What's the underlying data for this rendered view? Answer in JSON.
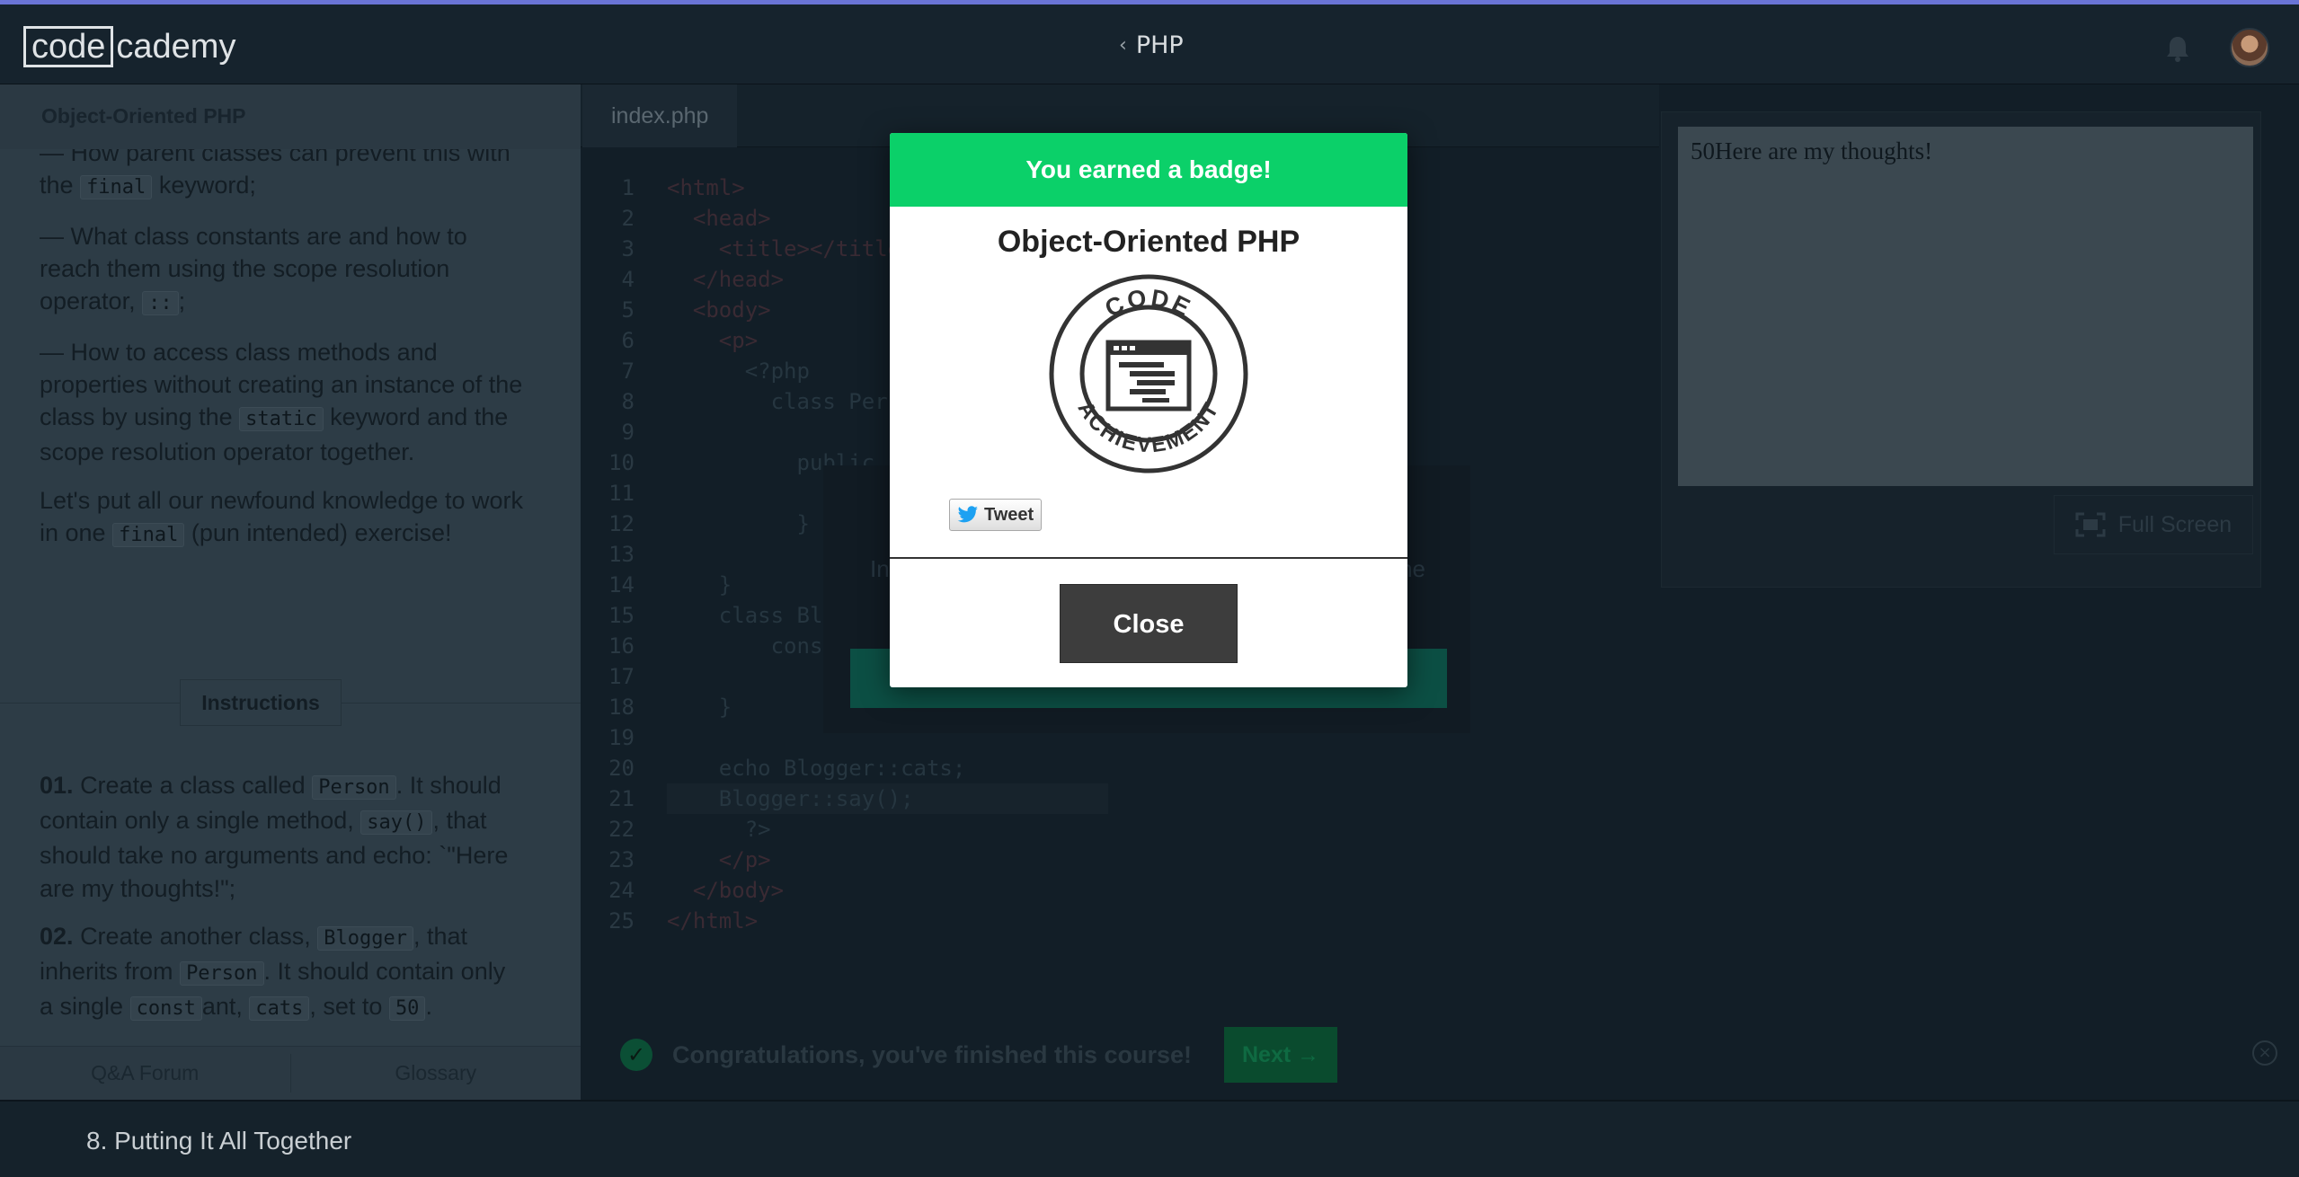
{
  "header": {
    "logo_boxed": "code",
    "logo_rest": "cademy",
    "course_back_label": "PHP"
  },
  "lesson": {
    "sticky_title": "Object-Oriented PHP",
    "para1_a": "— How parent classes can prevent this with the",
    "para1_code": "final",
    "para1_b": "keyword;",
    "para2_a": "— What class constants are and how to reach them using the scope resolution operator,",
    "para2_code": "::",
    "para2_b": ";",
    "para3_a": "— How to access class methods and properties without creating an instance of the class by using the",
    "para3_code": "static",
    "para3_b": "keyword and the scope resolution operator together.",
    "para4_a": "Let's put all our newfound knowledge to work in one",
    "para4_code": "final",
    "para4_b": "(pun intended) exercise!",
    "instructions_label": "Instructions",
    "step1_num": "01.",
    "step1_a": "Create a class called",
    "step1_code1": "Person",
    "step1_b": ". It should contain only a single method,",
    "step1_code2": "say()",
    "step1_c": ", that should take no arguments and echo: `\"Here are my thoughts!\";",
    "step2_num": "02.",
    "step2_a": "Create another class,",
    "step2_code1": "Blogger",
    "step2_b": ", that inherits from",
    "step2_code2": "Person",
    "step2_c": ". It should contain only a single",
    "step2_code3": "const",
    "step2_d": "ant,",
    "step2_code4": "cats",
    "step2_e": ", set to",
    "step2_code5": "50",
    "step2_f": ".",
    "footer_qa": "Q&A Forum",
    "footer_glossary": "Glossary"
  },
  "editor": {
    "tab_label": "index.php",
    "line_numbers": [
      "1",
      "2",
      "3",
      "4",
      "5",
      "6",
      "7",
      "8",
      "9",
      "10",
      "11",
      "12",
      "13",
      "14",
      "15",
      "16",
      "17",
      "18",
      "19",
      "20",
      "21",
      "22",
      "23",
      "24",
      "25"
    ],
    "lines": [
      "<html>",
      "  <head>",
      "    <title></title>",
      "  </head>",
      "  <body>",
      "    <p>",
      "      <?php",
      "        class Person {",
      "",
      "          public function say() {",
      "",
      "          }",
      "",
      "    }",
      "    class Blogger extends Person {",
      "        const cats = 50;",
      "",
      "    }",
      "",
      "    echo Blogger::cats;",
      "    Blogger::say();",
      "      ?>",
      "    </p>",
      "  </body>",
      "</html>"
    ]
  },
  "output": {
    "browser_text": "50Here are my thoughts!",
    "fullscreen_label": "Full Screen"
  },
  "congrats": {
    "message": "Congratulations, you've finished this course!",
    "next_label": "Next →"
  },
  "under_dialog": {
    "text_left": "In",
    "text_right": "he"
  },
  "modal": {
    "header": "You earned a badge!",
    "badge_title": "Object-Oriented PHP",
    "badge_top_text": "CODE",
    "badge_bottom_text": "ACHIEVEMENT",
    "tweet_label": "Tweet",
    "close_label": "Close"
  },
  "bottombar": {
    "crumb": "8. Putting It All Together"
  }
}
